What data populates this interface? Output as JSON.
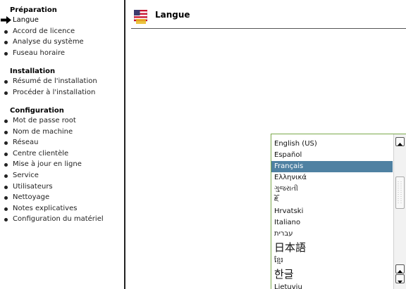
{
  "sidebar": {
    "sections": [
      {
        "title": "Préparation",
        "items": [
          {
            "label": "Langue",
            "current": true
          },
          {
            "label": "Accord de licence"
          },
          {
            "label": "Analyse du système"
          },
          {
            "label": "Fuseau horaire"
          }
        ]
      },
      {
        "title": "Installation",
        "items": [
          {
            "label": "Résumé de l'installation"
          },
          {
            "label": "Procéder à l'installation"
          }
        ]
      },
      {
        "title": "Configuration",
        "items": [
          {
            "label": "Mot de passe root"
          },
          {
            "label": "Nom de machine"
          },
          {
            "label": "Réseau"
          },
          {
            "label": "Centre clientèle"
          },
          {
            "label": "Mise à jour en ligne"
          },
          {
            "label": "Service"
          },
          {
            "label": "Utilisateurs"
          },
          {
            "label": "Nettoyage"
          },
          {
            "label": "Notes explicatives"
          },
          {
            "label": "Configuration du matériel"
          }
        ]
      }
    ]
  },
  "header": {
    "title": "Langue",
    "icon": "us-flag-icon"
  },
  "language_list": {
    "selected": "Français",
    "items": [
      "English (US)",
      "Español",
      "Français",
      "Ελληνικά",
      "ગુજરાતી",
      "ཇོ",
      "Hrvatski",
      "Italiano",
      "עברית",
      "日本語",
      "ខ្មែរ",
      "한글",
      "Lietuvių"
    ]
  },
  "colors": {
    "selection": "#4f81a2",
    "list_border": "#7aa84a"
  }
}
